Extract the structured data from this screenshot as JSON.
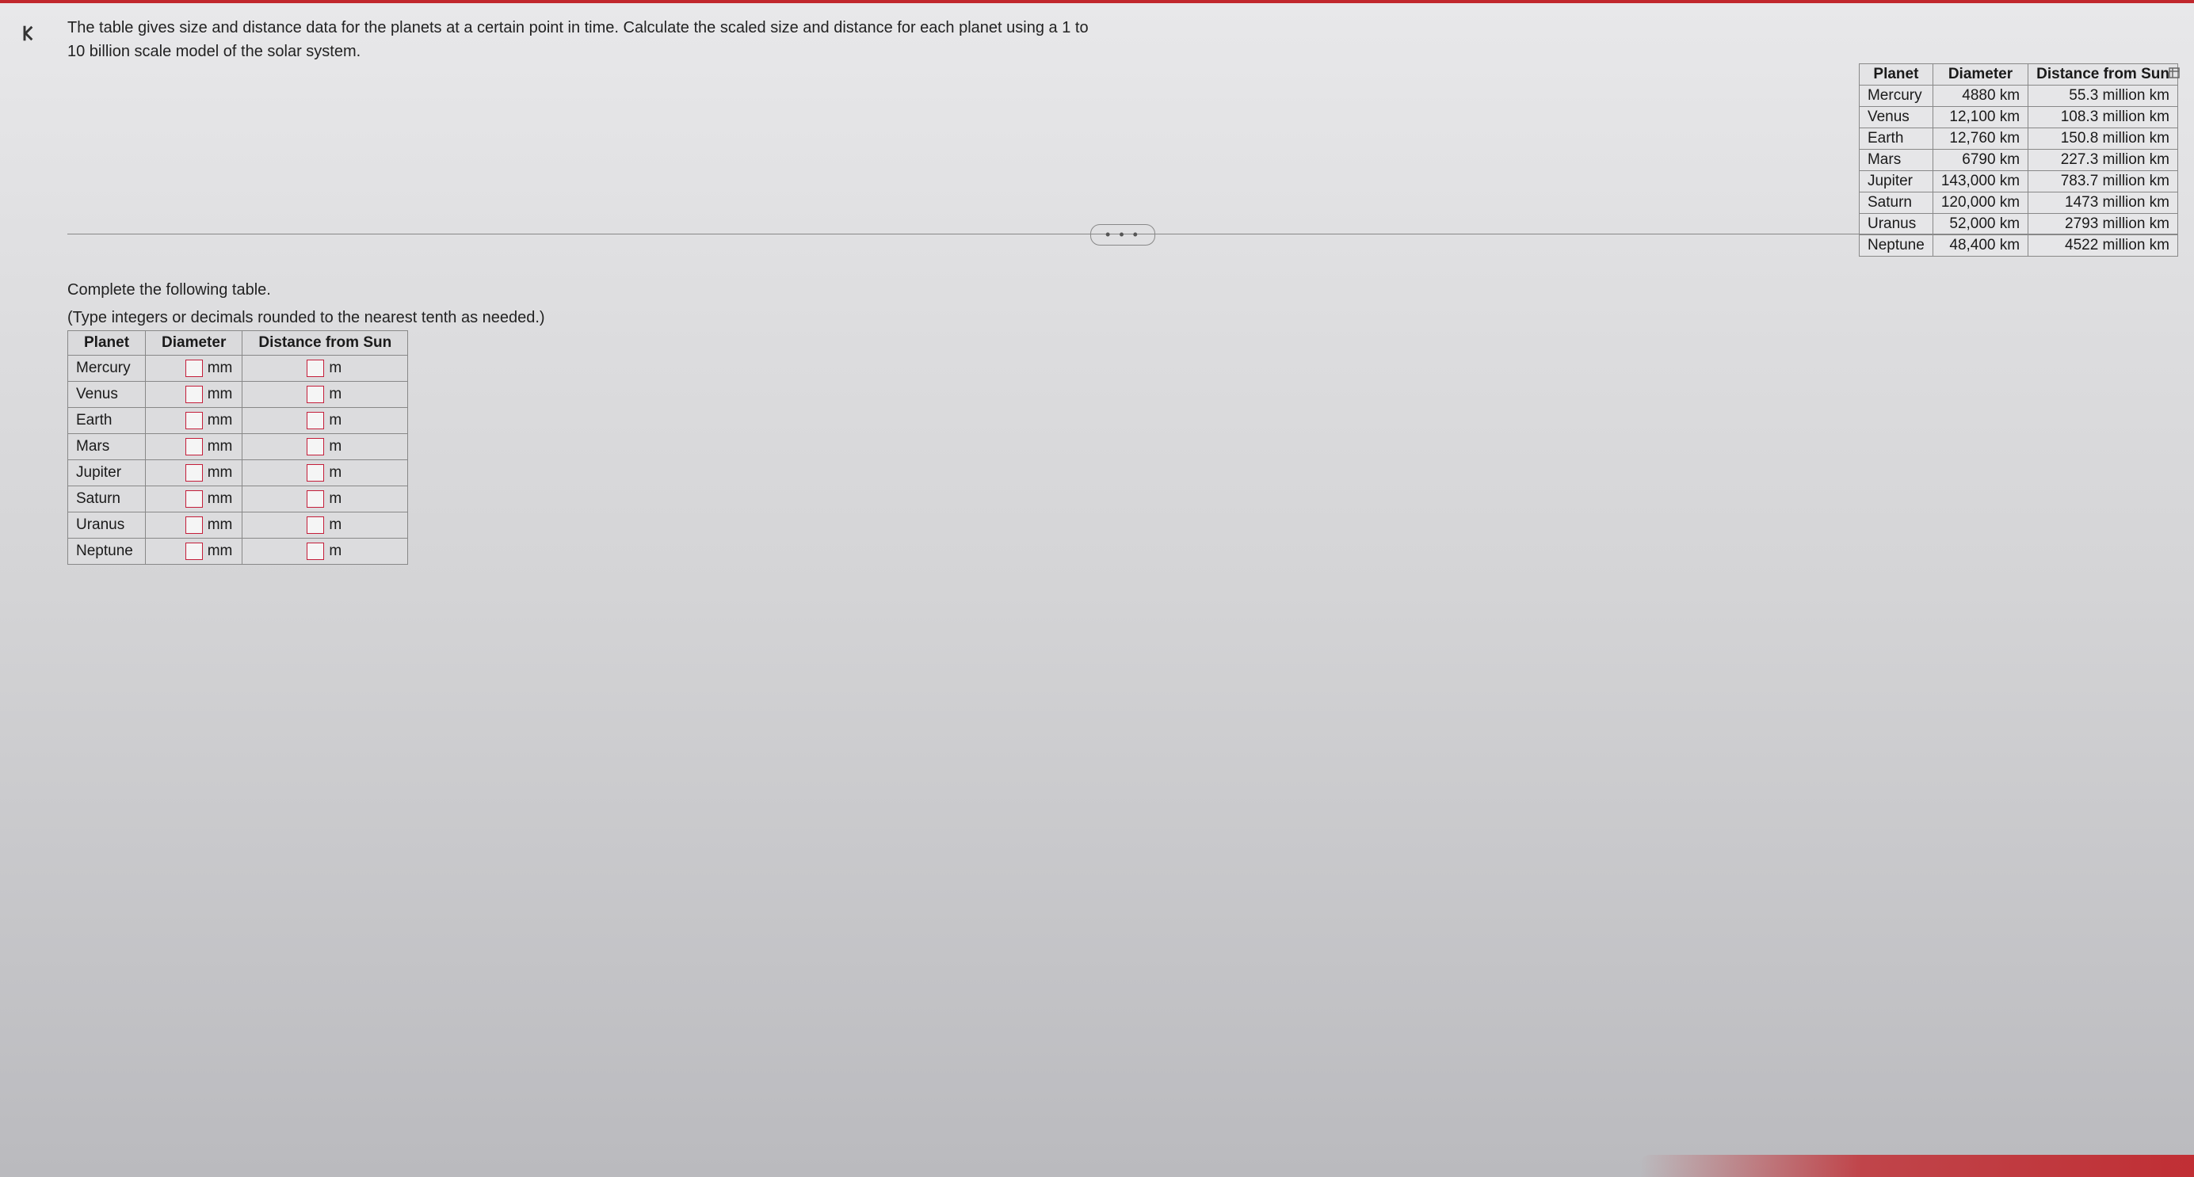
{
  "problem_text": "The table gives size and distance data for the planets at a certain point in time. Calculate the scaled size and distance for each planet using a 1 to 10 billion scale model of the solar system.",
  "data_table": {
    "headers": {
      "planet": "Planet",
      "diameter": "Diameter",
      "distance": "Distance from Sun"
    },
    "rows": [
      {
        "planet": "Mercury",
        "diameter": "4880 km",
        "distance": "55.3 million km"
      },
      {
        "planet": "Venus",
        "diameter": "12,100 km",
        "distance": "108.3 million km"
      },
      {
        "planet": "Earth",
        "diameter": "12,760 km",
        "distance": "150.8 million km"
      },
      {
        "planet": "Mars",
        "diameter": "6790 km",
        "distance": "227.3 million km"
      },
      {
        "planet": "Jupiter",
        "diameter": "143,000 km",
        "distance": "783.7 million km"
      },
      {
        "planet": "Saturn",
        "diameter": "120,000 km",
        "distance": "1473 million km"
      },
      {
        "planet": "Uranus",
        "diameter": "52,000 km",
        "distance": "2793 million km"
      },
      {
        "planet": "Neptune",
        "diameter": "48,400 km",
        "distance": "4522 million km"
      }
    ]
  },
  "answer_section": {
    "complete_text": "Complete the following table.",
    "instructions": "(Type integers or decimals rounded to the nearest tenth as needed.)",
    "headers": {
      "planet": "Planet",
      "diameter": "Diameter",
      "distance": "Distance from Sun"
    },
    "diameter_unit": "mm",
    "distance_unit": "m",
    "rows": [
      {
        "planet": "Mercury"
      },
      {
        "planet": "Venus"
      },
      {
        "planet": "Earth"
      },
      {
        "planet": "Mars"
      },
      {
        "planet": "Jupiter"
      },
      {
        "planet": "Saturn"
      },
      {
        "planet": "Uranus"
      },
      {
        "planet": "Neptune"
      }
    ]
  },
  "dots": "• • •"
}
